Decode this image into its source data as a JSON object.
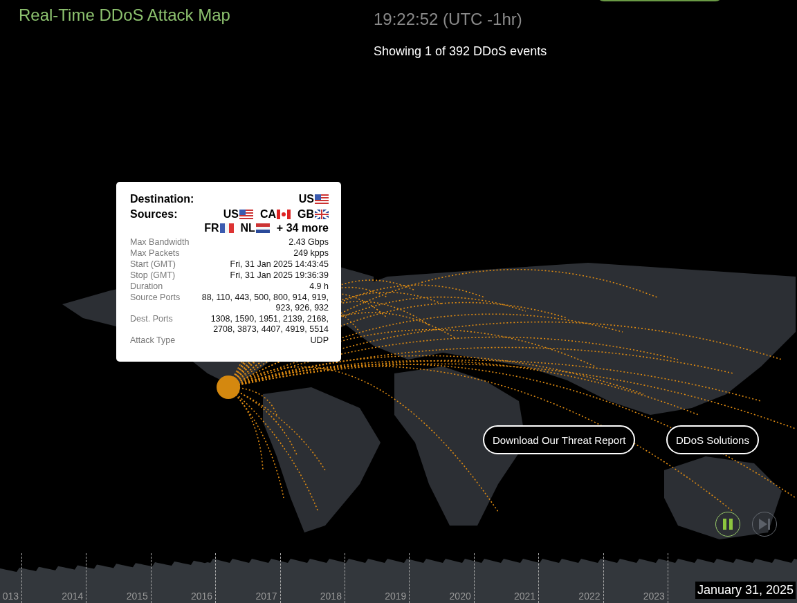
{
  "header": {
    "title": "Real-Time DDoS Attack Map",
    "time": "19:22:52 (UTC -1hr)",
    "showing": "Showing 1 of 392 DDoS events"
  },
  "tooltip": {
    "destination_label": "Destination:",
    "destination": {
      "code": "US",
      "kind": "us"
    },
    "sources_label": "Sources:",
    "sources": [
      {
        "code": "US",
        "kind": "us"
      },
      {
        "code": "CA",
        "kind": "ca"
      },
      {
        "code": "GB",
        "kind": "gb"
      },
      {
        "code": "FR",
        "kind": "fr"
      },
      {
        "code": "NL",
        "kind": "nl"
      }
    ],
    "more": "+ 34 more",
    "details": [
      {
        "label": "Max Bandwidth",
        "value": "2.43 Gbps"
      },
      {
        "label": "Max Packets",
        "value": "249 kpps"
      },
      {
        "label": "Start (GMT)",
        "value": "Fri, 31 Jan 2025 14:43:45"
      },
      {
        "label": "Stop (GMT)",
        "value": "Fri, 31 Jan 2025 19:36:39"
      },
      {
        "label": "Duration",
        "value": "4.9 h"
      },
      {
        "label": "Source Ports",
        "value": "88, 110, 443, 500, 800, 914, 919, 923, 926, 932"
      },
      {
        "label": "Dest. Ports",
        "value": "1308, 1590, 1951, 2139, 2168, 2708, 3873, 4407, 4919, 5514"
      },
      {
        "label": "Attack Type",
        "value": "UDP"
      }
    ]
  },
  "buttons": [
    "Download Our Threat Report",
    "DDoS Solutions"
  ],
  "playback": {
    "playing": true
  },
  "timeline": {
    "years": [
      "013",
      "2014",
      "2015",
      "2016",
      "2017",
      "2018",
      "2019",
      "2020",
      "2021",
      "2022",
      "2023"
    ],
    "date": "January 31, 2025"
  }
}
